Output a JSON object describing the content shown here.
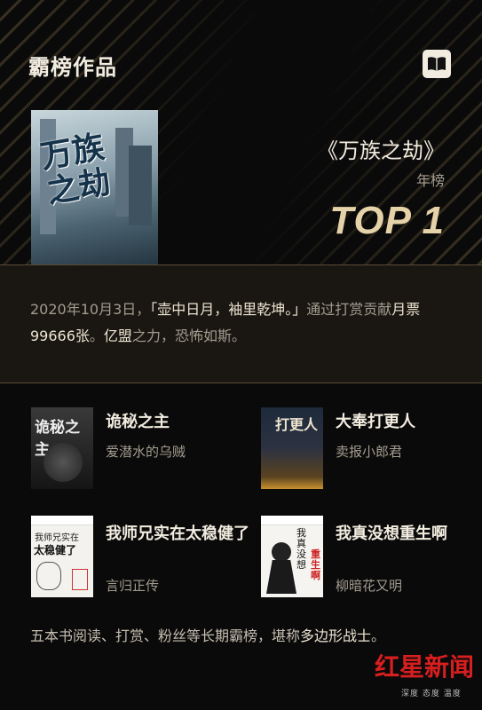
{
  "header": {
    "title": "霸榜作品"
  },
  "hero": {
    "cover_title": "万族之劫",
    "book_title": "《万族之劫》",
    "list_name": "年榜",
    "rank": "TOP 1"
  },
  "description": {
    "part1": "2020年10月3日，",
    "quote": "「壶中日月，袖里乾坤。」",
    "part2": "通过打赏贡献",
    "stat": "月票99666张",
    "part3": "。",
    "alliance": "亿盟",
    "part4": "之力，恐怖如斯。"
  },
  "books": [
    {
      "title": "诡秘之主",
      "author": "爱潜水的乌贼",
      "cover_text": "诡秘之主"
    },
    {
      "title": "大奉打更人",
      "author": "卖报小郎君",
      "cover_text": "打更人"
    },
    {
      "title": "我师兄实在太稳健了",
      "author": "言归正传",
      "cover_text_1": "我师兄实在",
      "cover_text_2": "太稳健了"
    },
    {
      "title": "我真没想重生啊",
      "author": "柳暗花又明",
      "cover_text_1": "我真没想",
      "cover_text_2": "重生啊"
    }
  ],
  "footer": {
    "text_a": "五本书阅读、打赏、粉丝等长期霸榜，堪称",
    "text_b": "多边形战士",
    "text_c": "。"
  },
  "watermark": {
    "brand": "红星新闻",
    "tagline": "深度 态度 温度"
  },
  "colors": {
    "accent_gold": "#e6d2a8",
    "brand_red": "#d81e1e",
    "background": "#0a0a0a"
  }
}
